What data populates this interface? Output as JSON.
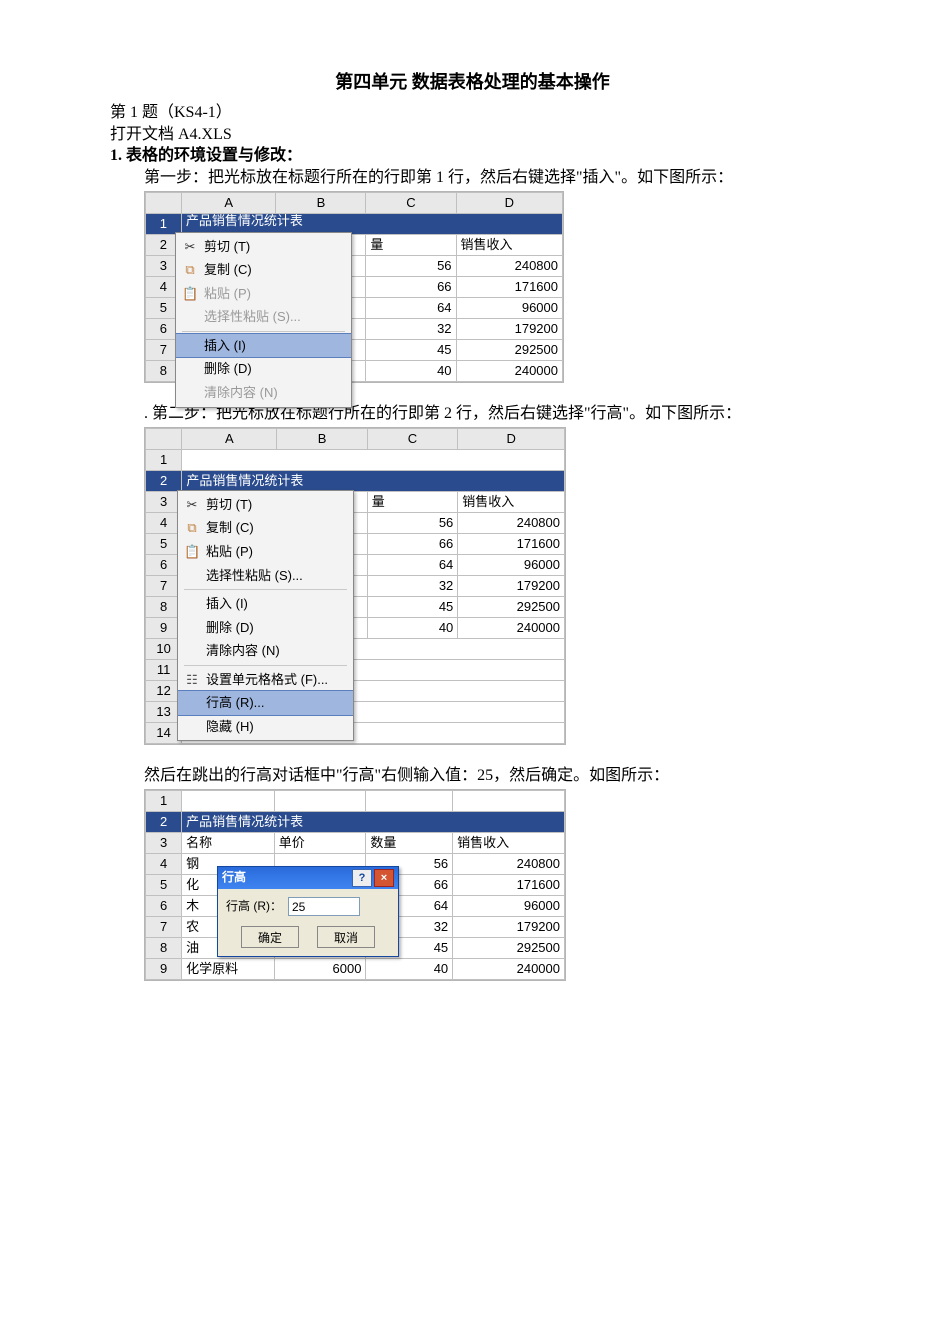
{
  "doc": {
    "title": "第四单元  数据表格处理的基本操作",
    "q_line": "第 1 题（KS4-1）",
    "open_line": "打开文档 A4.XLS",
    "sec1_num": "1.",
    "sec1_title": "表格的环境设置与修改：",
    "step1": "第一步：把光标放在标题行所在的行即第 1 行，然后右键选择\"插入\"。如下图所示：",
    "step2": ". 第二步：把光标放在标题行所在的行即第 2 行，然后右键选择\"行高\"。如下图所示：",
    "step3": "然后在跳出的行高对话框中\"行高\"右侧输入值：25，然后确定。如图所示："
  },
  "icons": {
    "cut_glyph": "✂",
    "copy_glyph": "⧉",
    "paste_glyph": "📋",
    "format_glyph": "☷",
    "help_glyph": "?",
    "close_glyph": "×"
  },
  "menu": {
    "cut": "剪切 (T)",
    "copy": "复制 (C)",
    "paste": "粘贴 (P)",
    "paste_special": "选择性粘贴 (S)...",
    "insert": "插入 (I)",
    "delete": "删除 (D)",
    "clear": "清除内容 (N)",
    "format_cells": "设置单元格格式 (F)...",
    "row_height": "行高 (R)...",
    "hide": "隐藏 (H)"
  },
  "headers": {
    "qty": "量",
    "rev": "销售收入",
    "A": "A",
    "B": "B",
    "C": "C",
    "D": "D"
  },
  "fig1": {
    "title_row": "产品销售情况统计表",
    "row_nums": [
      "1",
      "2",
      "3",
      "4",
      "5",
      "6",
      "7",
      "8"
    ],
    "qty": [
      56,
      66,
      64,
      32,
      45,
      40
    ],
    "rev": [
      240800,
      171600,
      96000,
      179200,
      292500,
      240000
    ]
  },
  "fig2": {
    "title_row": "产品销售情况统计表",
    "row_nums": [
      "1",
      "2",
      "3",
      "4",
      "5",
      "6",
      "7",
      "8",
      "9",
      "10",
      "11",
      "12",
      "13",
      "14"
    ],
    "qty": [
      56,
      66,
      64,
      32,
      45,
      40
    ],
    "rev": [
      240800,
      171600,
      96000,
      179200,
      292500,
      240000
    ]
  },
  "fig3": {
    "row_nums": [
      "1",
      "2",
      "3",
      "4",
      "5",
      "6",
      "7",
      "8",
      "9"
    ],
    "title_row": "产品销售情况统计表",
    "hdr_name": "名称",
    "hdr_price": "单价",
    "hdr_qty": "数量",
    "hdr_rev": "销售收入",
    "names": [
      "钢",
      "化",
      "木",
      "农",
      "油",
      "化学原料"
    ],
    "prices": [
      "",
      "",
      "",
      "",
      "",
      "6000"
    ],
    "qty": [
      "56",
      "66",
      "64",
      "32",
      "45",
      "40"
    ],
    "rev": [
      240800,
      171600,
      96000,
      179200,
      292500,
      240000
    ],
    "dlg_title": "行高",
    "dlg_label": "行高 (R)：",
    "dlg_value": "25",
    "ok": "确定",
    "cancel": "取消"
  }
}
